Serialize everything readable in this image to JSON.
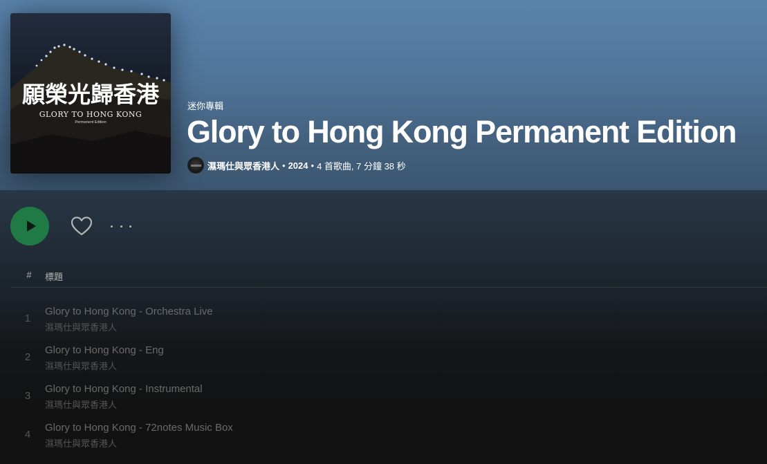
{
  "album": {
    "cover": {
      "title_cn": "願榮光歸香港",
      "title_en": "GLORY TO HONG KONG",
      "edition": "Permanent Edition"
    },
    "type_label": "迷你專輯",
    "title": "Glory to Hong Kong Permanent Edition",
    "artist": "濕瑪仕與眾香港人",
    "dot1": "•",
    "year": "2024",
    "dot2": "•",
    "counts": "4 首歌曲, 7 分鐘 38 秒"
  },
  "actions": {
    "play_icon": "play-icon",
    "like_icon": "heart-icon",
    "more_icon": "more-options-icon"
  },
  "list_header": {
    "number": "#",
    "title": "標題"
  },
  "tracks": [
    {
      "number": "1",
      "name": "Glory to Hong Kong - Orchestra Live",
      "artist": "濕瑪仕與眾香港人"
    },
    {
      "number": "2",
      "name": "Glory to Hong Kong - Eng",
      "artist": "濕瑪仕與眾香港人"
    },
    {
      "number": "3",
      "name": "Glory to Hong Kong - Instrumental",
      "artist": "濕瑪仕與眾香港人"
    },
    {
      "number": "4",
      "name": "Glory to Hong Kong - 72notes Music Box",
      "artist": "濕瑪仕與眾香港人"
    }
  ],
  "colors": {
    "header_bg": "#5a84ad",
    "play_button": "#1f7a45",
    "background": "#121212"
  }
}
